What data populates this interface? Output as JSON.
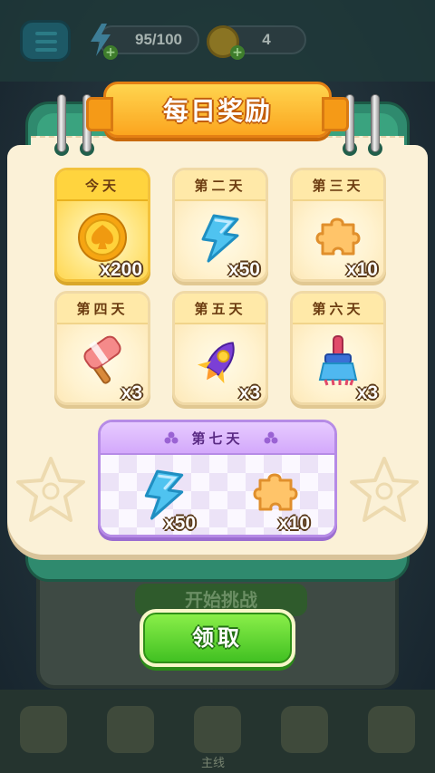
{
  "hud": {
    "energy": "95/100",
    "coins": "4"
  },
  "dialog": {
    "title": "每日奖励",
    "days": [
      {
        "label": "今天",
        "reward": "coin-icon",
        "quantity": "x200",
        "state": "today"
      },
      {
        "label": "第二天",
        "reward": "lightning-icon",
        "quantity": "x50"
      },
      {
        "label": "第三天",
        "reward": "puzzle-piece-icon",
        "quantity": "x10"
      },
      {
        "label": "第四天",
        "reward": "hammer-icon",
        "quantity": "x3"
      },
      {
        "label": "第五天",
        "reward": "rocket-icon",
        "quantity": "x3"
      },
      {
        "label": "第六天",
        "reward": "brush-icon",
        "quantity": "x3"
      }
    ],
    "day7": {
      "label": "第七天",
      "rewards": [
        {
          "reward": "lightning-icon",
          "quantity": "x50"
        },
        {
          "reward": "puzzle-piece-icon",
          "quantity": "x10"
        }
      ]
    },
    "claim_label": "领取"
  },
  "background": {
    "start_label": "开始挑战",
    "nav_label": "主线"
  },
  "colors": {
    "title_ribbon": "#fba51f",
    "claim_button": "#3fbf21",
    "day7_accent": "#b68be6",
    "calendar_frame": "#2f8a6e"
  }
}
